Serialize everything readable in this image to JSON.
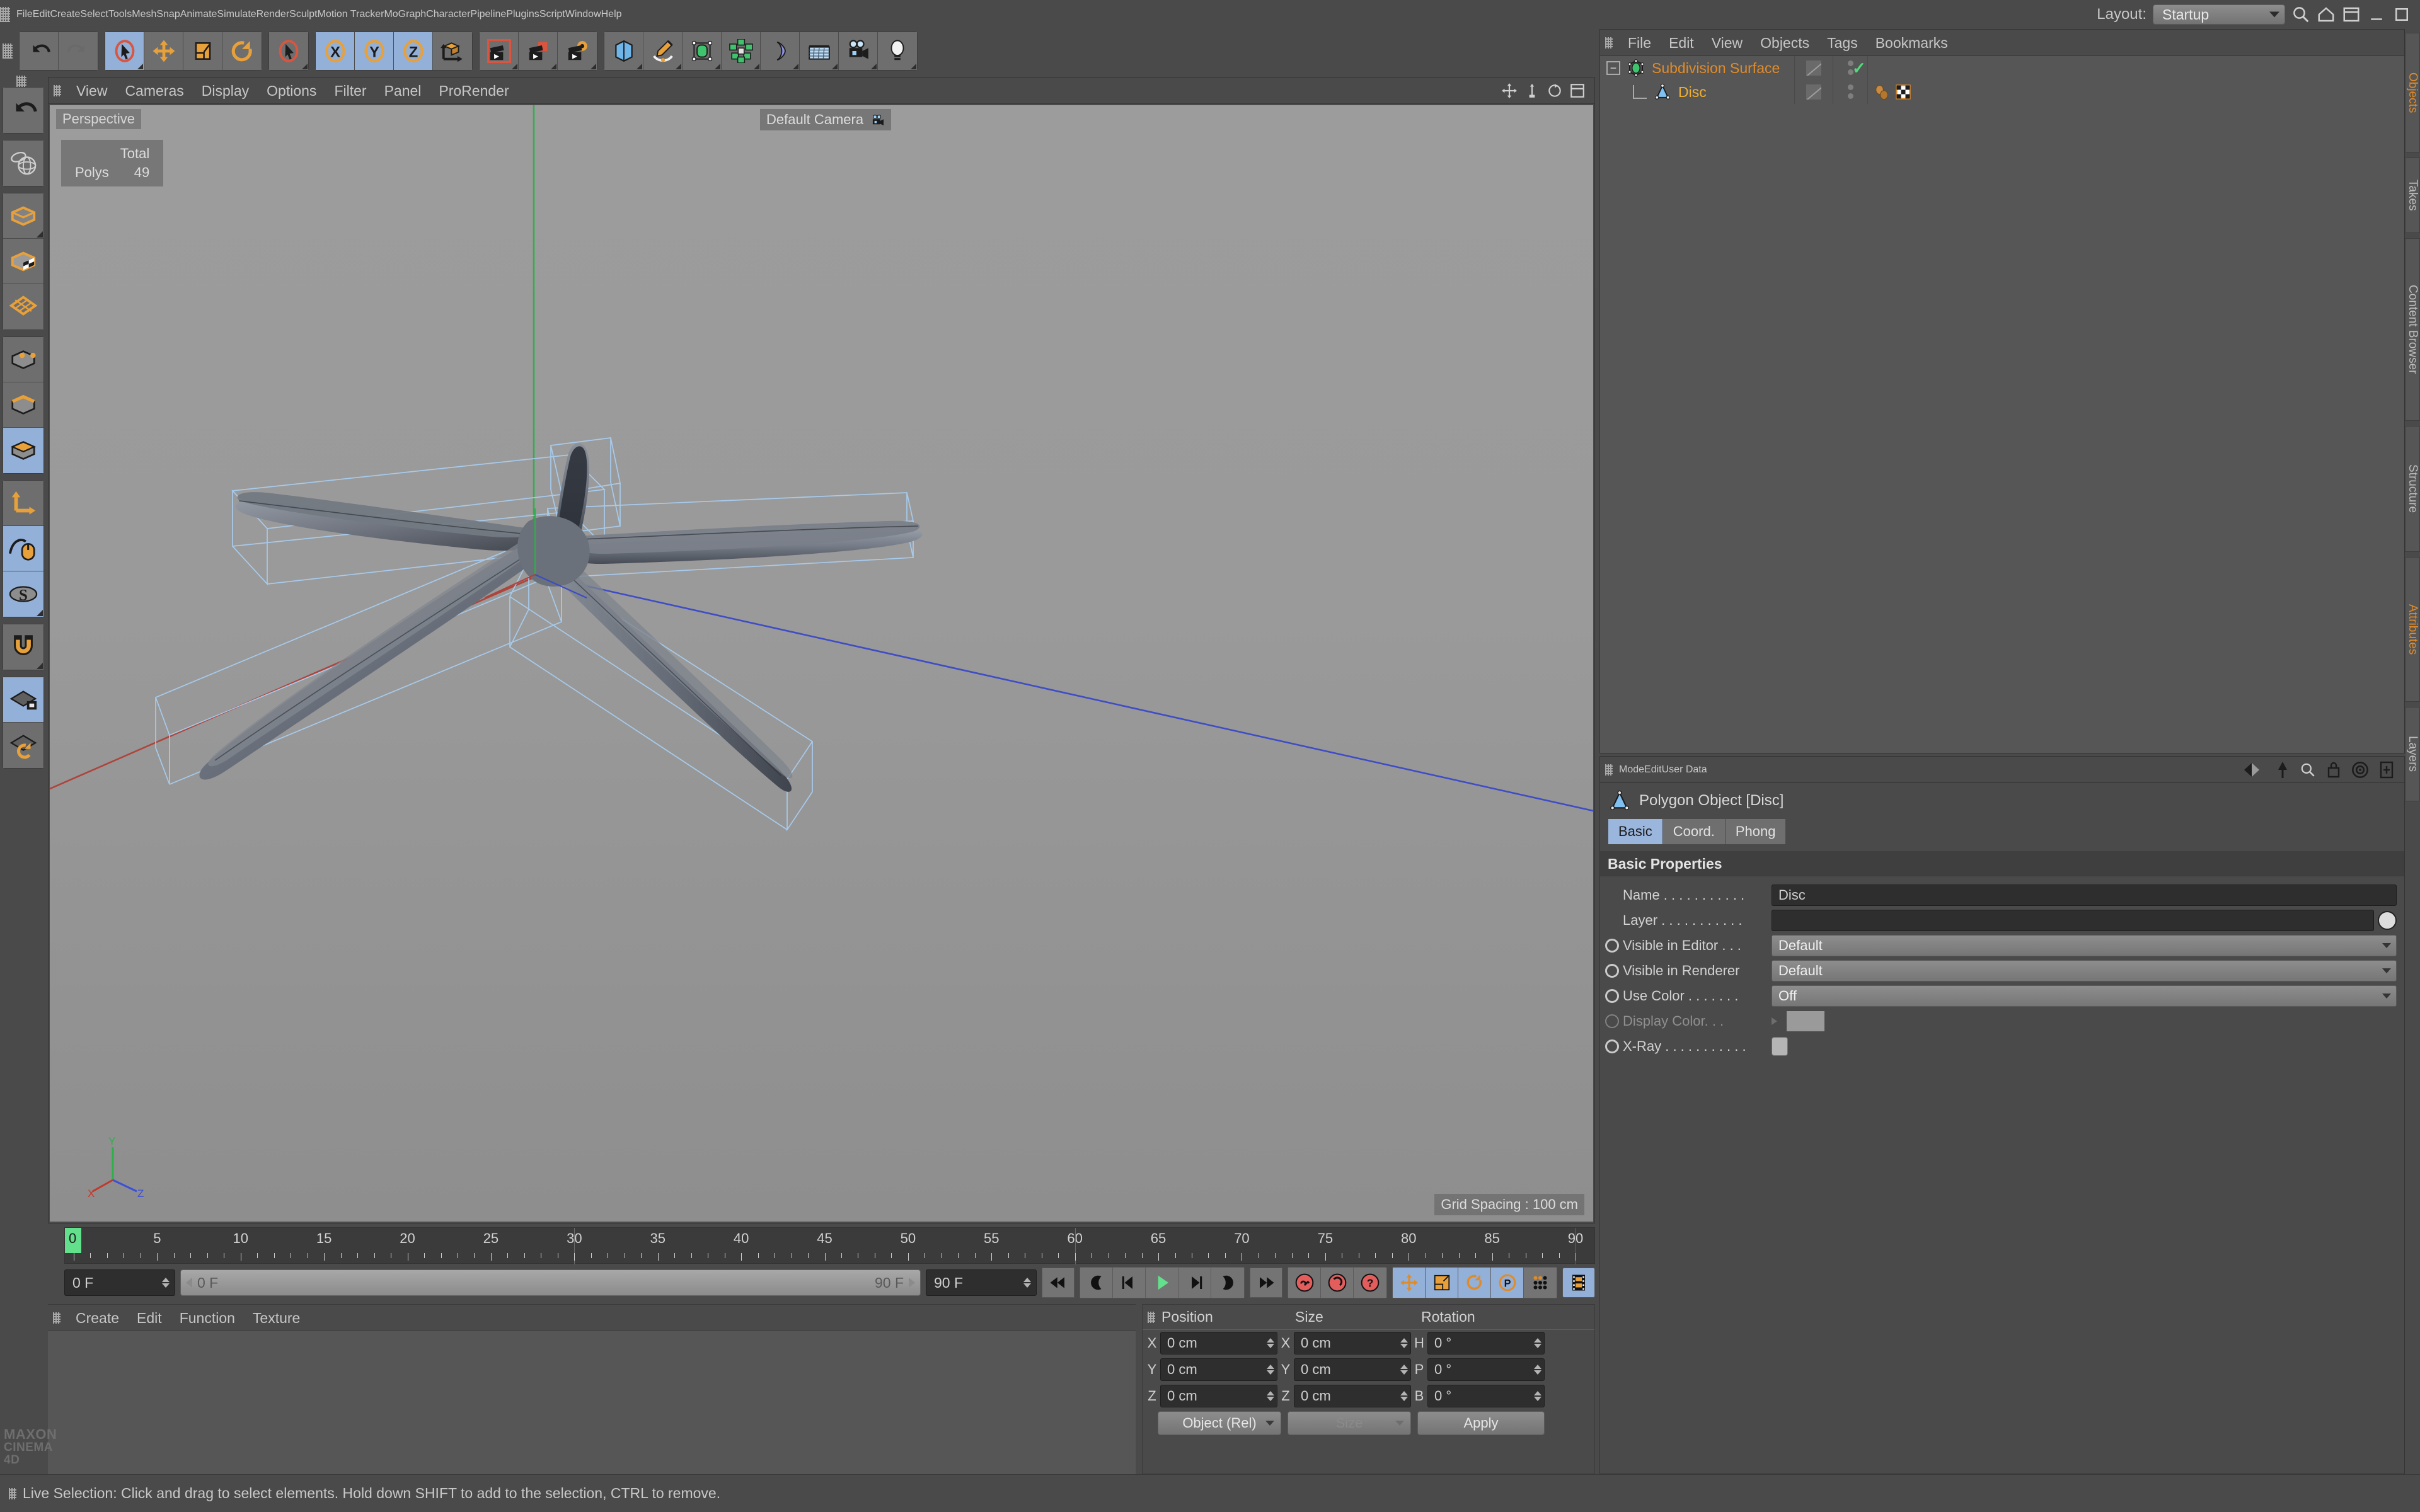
{
  "app": {
    "brand_line1": "MAXON",
    "brand_line2": "CINEMA 4D"
  },
  "menubar": {
    "items": [
      "File",
      "Edit",
      "Create",
      "Select",
      "Tools",
      "Mesh",
      "Snap",
      "Animate",
      "Simulate",
      "Render",
      "Sculpt",
      "Motion Tracker",
      "MoGraph",
      "Character",
      "Pipeline",
      "Plugins",
      "Script",
      "Window",
      "Help"
    ],
    "layout_label": "Layout:",
    "layout_value": "Startup",
    "search_icon": "search-icon"
  },
  "toolbar": {
    "groups": [
      {
        "name": "history",
        "buttons": [
          {
            "name": "undo",
            "icon": "undo-arrow-icon",
            "active": false,
            "corner": false
          },
          {
            "name": "redo",
            "icon": "redo-arrow-icon",
            "active": false,
            "corner": false
          }
        ]
      },
      {
        "name": "transform",
        "buttons": [
          {
            "name": "live-selection",
            "icon": "cursor-select-icon",
            "active": true,
            "corner": true
          },
          {
            "name": "move",
            "icon": "move-arrows-icon",
            "active": false,
            "corner": false
          },
          {
            "name": "scale",
            "icon": "scale-icon",
            "active": false,
            "corner": false
          },
          {
            "name": "rotate",
            "icon": "rotate-icon",
            "active": false,
            "corner": false
          }
        ]
      },
      {
        "name": "last-tool",
        "buttons": [
          {
            "name": "last-used-tool",
            "icon": "cursor-select-icon",
            "active": false,
            "corner": true
          }
        ]
      },
      {
        "name": "axis-lock",
        "buttons": [
          {
            "name": "lock-x",
            "icon": "axis-x-icon",
            "active": true,
            "corner": false
          },
          {
            "name": "lock-y",
            "icon": "axis-y-icon",
            "active": true,
            "corner": false
          },
          {
            "name": "lock-z",
            "icon": "axis-z-icon",
            "active": true,
            "corner": false
          },
          {
            "name": "world-object-coord",
            "icon": "world-coord-cube-icon",
            "active": false,
            "corner": false
          }
        ]
      },
      {
        "name": "render",
        "buttons": [
          {
            "name": "render-view",
            "icon": "render-view-clapper-icon",
            "active": false,
            "corner": true
          },
          {
            "name": "render-to-picture-viewer",
            "icon": "render-picture-clapper-icon",
            "active": false,
            "corner": true
          },
          {
            "name": "render-settings",
            "icon": "render-settings-gear-icon",
            "active": false,
            "corner": true
          }
        ]
      },
      {
        "name": "create",
        "buttons": [
          {
            "name": "add-cube-primitive",
            "icon": "cube-primitive-icon",
            "active": false,
            "corner": true
          },
          {
            "name": "add-spline",
            "icon": "pen-spline-icon",
            "active": false,
            "corner": true
          },
          {
            "name": "add-generator",
            "icon": "nurbs-generator-icon",
            "active": false,
            "corner": true
          },
          {
            "name": "add-array-modeling",
            "icon": "array-modeling-icon",
            "active": false,
            "corner": true
          },
          {
            "name": "add-deformer",
            "icon": "bend-deformer-icon",
            "active": false,
            "corner": true
          },
          {
            "name": "add-floor-environment",
            "icon": "floor-scene-icon",
            "active": false,
            "corner": true
          },
          {
            "name": "add-camera",
            "icon": "camera-icon",
            "active": false,
            "corner": true
          },
          {
            "name": "add-light",
            "icon": "light-bulb-icon",
            "active": false,
            "corner": true
          }
        ]
      }
    ]
  },
  "left_toolbar": {
    "groups": [
      {
        "name": "undo-group",
        "buttons": [
          {
            "name": "undo-view",
            "icon": "undo-arrow-icon",
            "active": false,
            "corner": false
          }
        ]
      },
      {
        "name": "selection-group",
        "buttons": [
          {
            "name": "make-editable",
            "icon": "wireframe-sphere-icon",
            "active": false,
            "corner": false
          }
        ]
      },
      {
        "name": "mode-group-1",
        "buttons": [
          {
            "name": "model-mode",
            "icon": "model-box-icon",
            "active": false,
            "corner": true
          },
          {
            "name": "texture-mode",
            "icon": "texture-checker-box-icon",
            "active": false,
            "corner": false
          },
          {
            "name": "workplane-mode",
            "icon": "workplane-grid-icon",
            "active": false,
            "corner": false
          }
        ]
      },
      {
        "name": "component-group",
        "buttons": [
          {
            "name": "points-mode",
            "icon": "points-box-icon",
            "active": false,
            "corner": false
          },
          {
            "name": "edges-mode",
            "icon": "edges-box-icon",
            "active": false,
            "corner": false
          },
          {
            "name": "polygons-mode",
            "icon": "polygons-box-icon",
            "active": true,
            "corner": false
          }
        ]
      },
      {
        "name": "axis-group",
        "buttons": [
          {
            "name": "enable-axis-modification",
            "icon": "axis-modify-icon",
            "active": false,
            "corner": false
          },
          {
            "name": "soft-selection",
            "icon": "soft-interaction-mouse-icon",
            "active": true,
            "corner": false
          },
          {
            "name": "viewport-solo",
            "icon": "solo-s-disc-icon",
            "active": true,
            "corner": true
          }
        ]
      },
      {
        "name": "snap-group",
        "buttons": [
          {
            "name": "enable-snapping",
            "icon": "magnet-icon",
            "active": false,
            "corner": true
          }
        ]
      },
      {
        "name": "workplane-group",
        "buttons": [
          {
            "name": "lock-workplane",
            "icon": "workplane-lock-icon",
            "active": true,
            "corner": false
          },
          {
            "name": "planar-workplane-toggle",
            "icon": "workplane-rotate-icon",
            "active": false,
            "corner": false
          }
        ]
      }
    ]
  },
  "viewport": {
    "menu": [
      "View",
      "Cameras",
      "Display",
      "Options",
      "Filter",
      "Panel",
      "ProRender"
    ],
    "mode_label": "Perspective",
    "camera_label": "Default Camera",
    "camera_icon": "camera-icon",
    "stats": {
      "header": "Total",
      "rows": [
        {
          "label": "Polys",
          "value": "49"
        }
      ]
    },
    "grid_spacing": "Grid Spacing : 100 cm",
    "axis_gizmo": {
      "x": "X",
      "y": "Y",
      "z": "Z"
    },
    "corner_icons": [
      "viewport-move-icon",
      "viewport-scale-icon",
      "viewport-rotate-icon",
      "viewport-maximize-icon"
    ],
    "colors": {
      "x_axis": "#c0392b",
      "y_axis": "#2ecc40",
      "z_axis": "#3b4fd8",
      "wireframe": "#9fc6ee",
      "bg_top": "#9c9c9c",
      "bg_bottom": "#8e8e8e"
    }
  },
  "timeline": {
    "ticks": [
      0,
      5,
      10,
      15,
      20,
      25,
      30,
      35,
      40,
      45,
      50,
      55,
      60,
      65,
      70,
      75,
      80,
      85,
      90
    ],
    "start_frame_value": "0 F",
    "current_frame_left": "0 F",
    "current_frame_right": "90 F",
    "end_frame_value": "90 F",
    "playback_buttons": [
      {
        "name": "go-to-start",
        "icon": "skip-start-icon"
      },
      {
        "name": "previous-keyframe",
        "icon": "prev-keyframe-icon"
      },
      {
        "name": "previous-frame",
        "icon": "step-back-icon"
      },
      {
        "name": "play-forward",
        "icon": "play-icon"
      },
      {
        "name": "next-frame",
        "icon": "step-forward-icon"
      },
      {
        "name": "next-keyframe",
        "icon": "next-keyframe-icon"
      },
      {
        "name": "go-to-end",
        "icon": "skip-end-icon"
      }
    ],
    "record_buttons": [
      {
        "name": "record-active-objects",
        "icon": "record-key-icon"
      },
      {
        "name": "autokeying",
        "icon": "autokey-icon"
      },
      {
        "name": "keyframe-selection",
        "icon": "key-question-icon"
      }
    ],
    "key_toggles": [
      {
        "name": "position-key",
        "icon": "move-arrows-icon",
        "active": true
      },
      {
        "name": "scale-key",
        "icon": "scale-icon",
        "active": true
      },
      {
        "name": "rotation-key",
        "icon": "rotate-icon",
        "active": true
      },
      {
        "name": "parameter-key",
        "icon": "param-p-icon",
        "active": true
      },
      {
        "name": "point-level-animation",
        "icon": "pla-dots-icon",
        "active": false
      }
    ],
    "timeline_toggle": {
      "name": "animation-filmstrip",
      "icon": "filmstrip-icon",
      "active": true
    }
  },
  "material_manager": {
    "menu": [
      "Create",
      "Edit",
      "Function",
      "Texture"
    ],
    "materials": []
  },
  "coordinates": {
    "headers": [
      "Position",
      "Size",
      "Rotation"
    ],
    "rows": [
      {
        "pos_axis": "X",
        "pos_value": "0 cm",
        "size_axis": "X",
        "size_value": "0 cm",
        "rot_axis": "H",
        "rot_value": "0 °"
      },
      {
        "pos_axis": "Y",
        "pos_value": "0 cm",
        "size_axis": "Y",
        "size_value": "0 cm",
        "rot_axis": "P",
        "rot_value": "0 °"
      },
      {
        "pos_axis": "Z",
        "pos_value": "0 cm",
        "size_axis": "Z",
        "size_value": "0 cm",
        "rot_axis": "B",
        "rot_value": "0 °"
      }
    ],
    "mode_dropdown": "Object (Rel)",
    "size_dropdown": "Size",
    "apply_button": "Apply"
  },
  "object_manager": {
    "menu": [
      "File",
      "Edit",
      "View",
      "Objects",
      "Tags",
      "Bookmarks"
    ],
    "rows": [
      {
        "name": "Subdivision Surface",
        "icon": "subdivision-surface-icon",
        "depth": 0,
        "color": "#e08b2a",
        "expanded": true,
        "enabled_check": "✓",
        "tags": []
      },
      {
        "name": "Disc",
        "icon": "polygon-object-icon",
        "depth": 1,
        "color": "#f0b030",
        "expanded": false,
        "enabled_check": "",
        "tags": [
          "phong-tag-icon",
          "texture-checker-tag-icon"
        ]
      }
    ]
  },
  "attributes": {
    "menu": [
      "Mode",
      "Edit",
      "User Data"
    ],
    "tool_icons": [
      "history-back-icon",
      "pin-icon",
      "search-icon",
      "lock-icon",
      "target-icon",
      "panel-icon"
    ],
    "object_title": "Polygon Object [Disc]",
    "object_icon": "polygon-object-icon",
    "tabs": [
      {
        "label": "Basic",
        "selected": true
      },
      {
        "label": "Coord.",
        "selected": false
      },
      {
        "label": "Phong",
        "selected": false
      }
    ],
    "section_title": "Basic Properties",
    "properties": [
      {
        "label": "Name . . . . . . . . . . .",
        "type": "text",
        "value": "Disc",
        "disabled": false,
        "radio": false
      },
      {
        "label": "Layer . . . . . . . . . . .",
        "type": "layer",
        "value": "",
        "disabled": false,
        "radio": false
      },
      {
        "label": "Visible in Editor . . .",
        "type": "dropdown",
        "value": "Default",
        "disabled": false,
        "radio": true
      },
      {
        "label": "Visible in Renderer",
        "type": "dropdown",
        "value": "Default",
        "disabled": false,
        "radio": true
      },
      {
        "label": "Use Color . . . . . . .",
        "type": "dropdown",
        "value": "Off",
        "disabled": false,
        "radio": true
      },
      {
        "label": "Display Color. . .",
        "type": "swatch",
        "value": "",
        "disabled": true,
        "radio": true
      },
      {
        "label": "X-Ray . . . . . . . . . . .",
        "type": "checkbox",
        "value": "",
        "disabled": false,
        "radio": true
      }
    ]
  },
  "right_rail": {
    "tabs": [
      {
        "label": "Objects",
        "accent": true
      },
      {
        "label": "Takes",
        "accent": false
      },
      {
        "label": "Content Browser",
        "accent": false
      },
      {
        "label": "Structure",
        "accent": false
      },
      {
        "label": "Attributes",
        "accent": true
      },
      {
        "label": "Layers",
        "accent": false
      }
    ]
  },
  "status_bar": {
    "message": "Live Selection: Click and drag to select elements. Hold down SHIFT to add to the selection, CTRL to remove."
  }
}
